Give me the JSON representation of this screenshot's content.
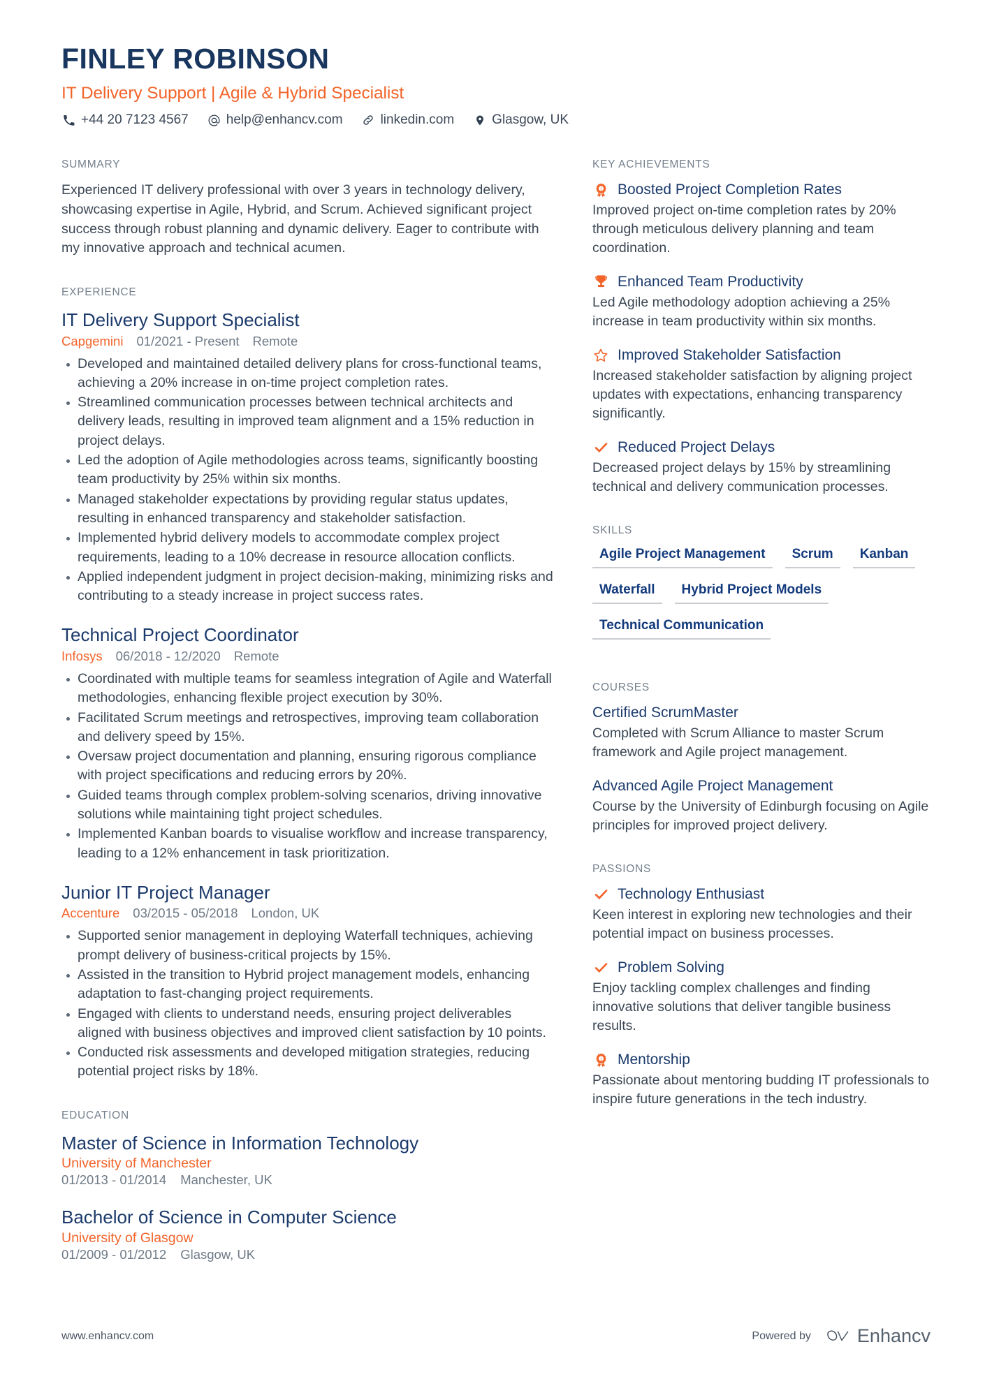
{
  "header": {
    "name": "FINLEY ROBINSON",
    "role": "IT Delivery Support | Agile & Hybrid Specialist",
    "contacts": [
      {
        "icon": "phone-icon",
        "text": "+44 20 7123 4567"
      },
      {
        "icon": "email-icon",
        "text": "help@enhancv.com"
      },
      {
        "icon": "link-icon",
        "text": "linkedin.com"
      },
      {
        "icon": "location-pin-icon",
        "text": "Glasgow, UK"
      }
    ]
  },
  "summary": {
    "label": "SUMMARY",
    "text": "Experienced IT delivery professional with over 3 years in technology delivery, showcasing expertise in Agile, Hybrid, and Scrum. Achieved significant project success through robust planning and dynamic delivery. Eager to contribute with my innovative approach and technical acumen."
  },
  "experience": {
    "label": "EXPERIENCE",
    "jobs": [
      {
        "title": "IT Delivery Support Specialist",
        "company": "Capgemini",
        "dates": "01/2021 - Present",
        "location": "Remote",
        "bullets": [
          "Developed and maintained detailed delivery plans for cross-functional teams, achieving a 20% increase in on-time project completion rates.",
          "Streamlined communication processes between technical architects and delivery leads, resulting in improved team alignment and a 15% reduction in project delays.",
          "Led the adoption of Agile methodologies across teams, significantly boosting team productivity by 25% within six months.",
          "Managed stakeholder expectations by providing regular status updates, resulting in enhanced transparency and stakeholder satisfaction.",
          "Implemented hybrid delivery models to accommodate complex project requirements, leading to a 10% decrease in resource allocation conflicts.",
          "Applied independent judgment in project decision-making, minimizing risks and contributing to a steady increase in project success rates."
        ]
      },
      {
        "title": "Technical Project Coordinator",
        "company": "Infosys",
        "dates": "06/2018 - 12/2020",
        "location": "Remote",
        "bullets": [
          "Coordinated with multiple teams for seamless integration of Agile and Waterfall methodologies, enhancing flexible project execution by 30%.",
          "Facilitated Scrum meetings and retrospectives, improving team collaboration and delivery speed by 15%.",
          "Oversaw project documentation and planning, ensuring rigorous compliance with project specifications and reducing errors by 20%.",
          "Guided teams through complex problem-solving scenarios, driving innovative solutions while maintaining tight project schedules.",
          "Implemented Kanban boards to visualise workflow and increase transparency, leading to a 12% enhancement in task prioritization."
        ]
      },
      {
        "title": "Junior IT Project Manager",
        "company": "Accenture",
        "dates": "03/2015 - 05/2018",
        "location": "London, UK",
        "bullets": [
          "Supported senior management in deploying Waterfall techniques, achieving prompt delivery of business-critical projects by 15%.",
          "Assisted in the transition to Hybrid project management models, enhancing adaptation to fast-changing project requirements.",
          "Engaged with clients to understand needs, ensuring project deliverables aligned with business objectives and improved client satisfaction by 10 points.",
          "Conducted risk assessments and developed mitigation strategies, reducing potential project risks by 18%."
        ]
      }
    ]
  },
  "education": {
    "label": "EDUCATION",
    "items": [
      {
        "degree": "Master of Science in Information Technology",
        "school": "University of Manchester",
        "dates": "01/2013 - 01/2014",
        "location": "Manchester, UK"
      },
      {
        "degree": "Bachelor of Science in Computer Science",
        "school": "University of Glasgow",
        "dates": "01/2009 - 01/2012",
        "location": "Glasgow, UK"
      }
    ]
  },
  "achievements": {
    "label": "KEY ACHIEVEMENTS",
    "items": [
      {
        "icon": "award-ribbon-icon",
        "title": "Boosted Project Completion Rates",
        "desc": "Improved project on-time completion rates by 20% through meticulous delivery planning and team coordination."
      },
      {
        "icon": "trophy-icon",
        "title": "Enhanced Team Productivity",
        "desc": "Led Agile methodology adoption achieving a 25% increase in team productivity within six months."
      },
      {
        "icon": "star-outline-icon",
        "title": "Improved Stakeholder Satisfaction",
        "desc": "Increased stakeholder satisfaction by aligning project updates with expectations, enhancing transparency significantly."
      },
      {
        "icon": "check-icon",
        "title": "Reduced Project Delays",
        "desc": "Decreased project delays by 15% by streamlining technical and delivery communication processes."
      }
    ]
  },
  "skills": {
    "label": "SKILLS",
    "items": [
      "Agile Project Management",
      "Scrum",
      "Kanban",
      "Waterfall",
      "Hybrid Project Models",
      "Technical Communication"
    ]
  },
  "courses": {
    "label": "COURSES",
    "items": [
      {
        "title": "Certified ScrumMaster",
        "desc": "Completed with Scrum Alliance to master Scrum framework and Agile project management."
      },
      {
        "title": "Advanced Agile Project Management",
        "desc": "Course by the University of Edinburgh focusing on Agile principles for improved project delivery."
      }
    ]
  },
  "passions": {
    "label": "PASSIONS",
    "items": [
      {
        "icon": "check-icon",
        "title": "Technology Enthusiast",
        "desc": "Keen interest in exploring new technologies and their potential impact on business processes."
      },
      {
        "icon": "check-icon",
        "title": "Problem Solving",
        "desc": "Enjoy tackling complex challenges and finding innovative solutions that deliver tangible business results."
      },
      {
        "icon": "award-ribbon-icon",
        "title": "Mentorship",
        "desc": "Passionate about mentoring budding IT professionals to inspire future generations in the tech industry."
      }
    ]
  },
  "footer": {
    "url": "www.enhancv.com",
    "powered_by": "Powered by",
    "brand": "Enhancv"
  },
  "colors": {
    "navy": "#1B3A6B",
    "orange": "#F2642A",
    "body": "#3B4754",
    "muted": "#75808C",
    "skill": "#133A7C"
  }
}
